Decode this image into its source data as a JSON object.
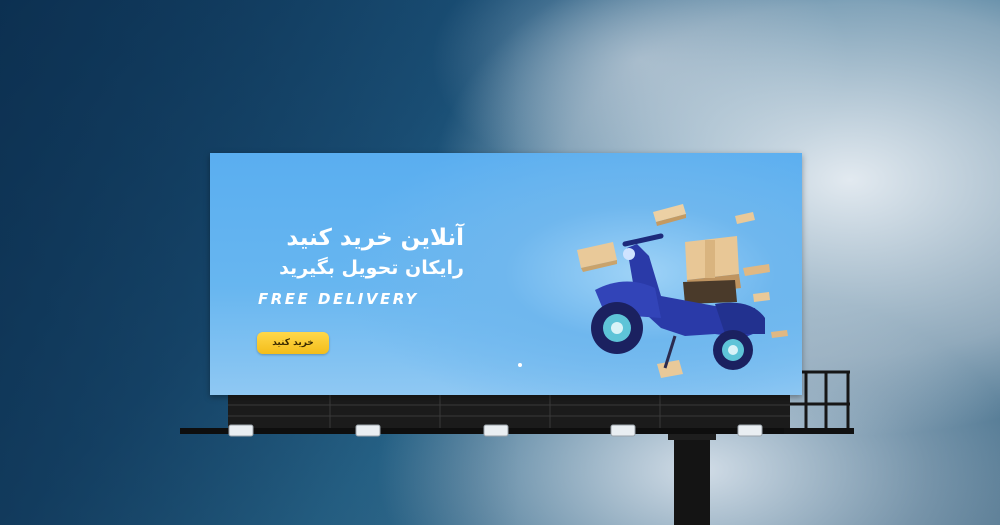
{
  "billboard": {
    "headline": "آنلاین خرید کنید",
    "subline": "رایکان تحویل بگیرید",
    "tagline": "FREE DELIVERY",
    "cta_label": "خرید کنید"
  },
  "illustration": {
    "subject": "scooter-icon",
    "accent_color": "#ffd84a",
    "board_color": "#5aaef0"
  }
}
